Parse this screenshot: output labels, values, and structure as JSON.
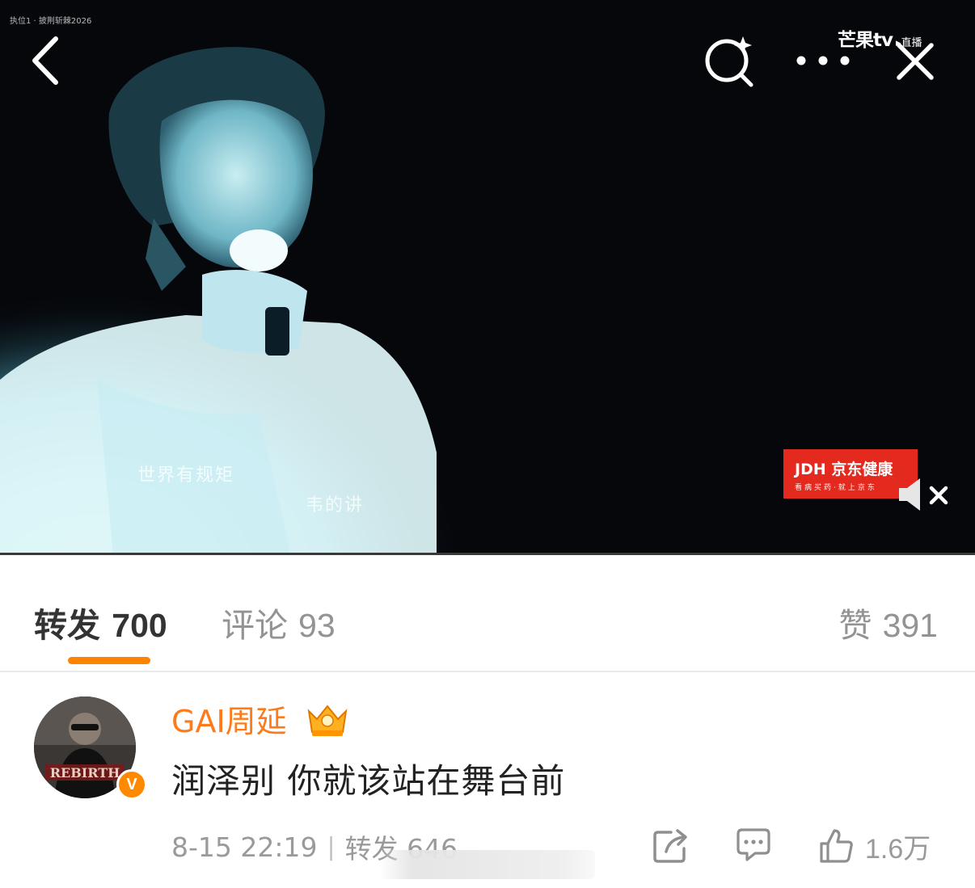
{
  "video": {
    "watermark": "执位1 · 披荆斩棘2026",
    "subtitles": [
      "世界有规矩",
      "韦的讲"
    ],
    "brand_logo": "芒果tv",
    "brand_live": "▸直播",
    "ad": {
      "title": "JDH 京东健康",
      "slogan": "看病买药·就上京东"
    },
    "progress_fraction": 0.0
  },
  "tabs": {
    "repost_label": "转发",
    "repost_count": "700",
    "comment_label": "评论",
    "comment_count": "93",
    "like_label": "赞",
    "like_count": "391",
    "active": "repost"
  },
  "repost": {
    "user_name": "GAI周延",
    "verified_mark": "V",
    "text": "润泽别 你就该站在舞台前",
    "timestamp": "8-15 22:19",
    "separator": "|",
    "repost_meta": "转发 646",
    "like_count": "1.6万"
  },
  "colors": {
    "accent": "#ff8200",
    "username": "#ff7a1a",
    "ad_red": "#e4291e"
  },
  "icons": [
    "back-icon",
    "search-sparkle-icon",
    "more-icon",
    "close-icon",
    "mute-icon",
    "crown-icon",
    "share-icon",
    "comment-icon",
    "like-icon"
  ]
}
